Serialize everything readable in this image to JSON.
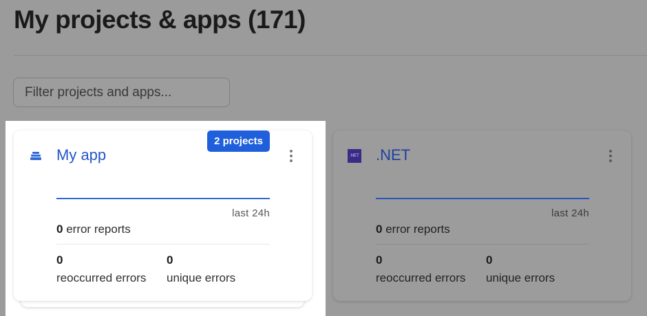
{
  "page": {
    "title": "My projects & apps (171)"
  },
  "filter": {
    "placeholder": "Filter projects and apps..."
  },
  "cards": [
    {
      "name": "My app",
      "badge": "2 projects",
      "icon": "stack-icon",
      "period": "last 24h",
      "error_reports_count": "0",
      "error_reports_label": "error reports",
      "reoccurred_count": "0",
      "reoccurred_label": "reoccurred errors",
      "unique_count": "0",
      "unique_label": "unique errors",
      "highlighted": true
    },
    {
      "name": ".NET",
      "icon": "dotnet-icon",
      "icon_text": ".NET",
      "period": "last 24h",
      "error_reports_count": "0",
      "error_reports_label": "error reports",
      "reoccurred_count": "0",
      "reoccurred_label": "reoccurred errors",
      "unique_count": "0",
      "unique_label": "unique errors",
      "highlighted": false
    }
  ],
  "colors": {
    "accent": "#1f5fdc",
    "link": "#2356c9",
    "overlay": "#9b9b9b"
  }
}
